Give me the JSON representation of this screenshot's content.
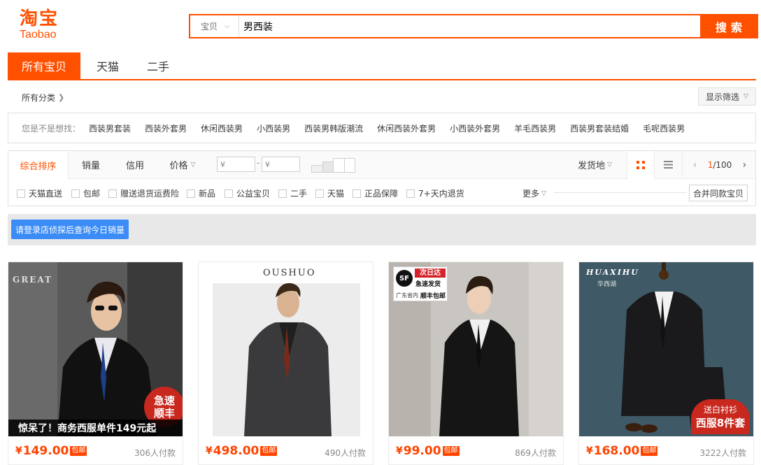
{
  "logo": {
    "cn": "淘宝",
    "en": "Taobao"
  },
  "search": {
    "category": "宝贝",
    "query": "男西装",
    "button": "搜索"
  },
  "tabs": [
    {
      "label": "所有宝贝",
      "active": true
    },
    {
      "label": "天猫",
      "active": false
    },
    {
      "label": "二手",
      "active": false
    }
  ],
  "breadcrumb": "所有分类",
  "filter_toggle": "显示筛选",
  "suggest": {
    "label": "您是不是想找：",
    "keywords": [
      "西装男套装",
      "西装外套男",
      "休闲西装男",
      "小西装男",
      "西装男韩版潮流",
      "休闲西装外套男",
      "小西装外套男",
      "羊毛西装男",
      "西装男套装结婚",
      "毛呢西装男"
    ]
  },
  "sort": {
    "options": [
      "综合排序",
      "销量",
      "信用",
      "价格"
    ],
    "price_min_placeholder": "¥",
    "price_max_placeholder": "¥",
    "ship_from": "发货地",
    "page_current": "1",
    "page_total": "/100"
  },
  "checkboxes": [
    "天猫直送",
    "包邮",
    "赠送退货运费险",
    "新品",
    "公益宝贝",
    "二手",
    "天猫",
    "正品保障",
    "7+天内退货"
  ],
  "more": "更多",
  "merge": "合并同款宝贝",
  "notice_button": "请登录店侦探后查询今日销量",
  "products": [
    {
      "price": "149.00",
      "sold": "306人付款",
      "free_ship": "包邮",
      "banner": "惊呆了！商务西服单件149元起",
      "badge": [
        "急速",
        "顺丰"
      ],
      "brand": "GREAT"
    },
    {
      "price": "498.00",
      "sold": "490人付款",
      "free_ship": "包邮",
      "brand": "OUSHUO"
    },
    {
      "price": "99.00",
      "sold": "869人付款",
      "free_ship": "包邮",
      "stamp": [
        "次日达",
        "急速发货",
        "广东省内",
        "顺丰包邮"
      ],
      "stamp_logo": "SF"
    },
    {
      "price": "168.00",
      "sold": "3222人付款",
      "free_ship": "包邮",
      "brand": "HUAXIHU",
      "brand_cn": "华西湖",
      "badge": [
        "送白衬衫",
        "西服8件套"
      ]
    }
  ],
  "currency": "¥",
  "colors": {
    "accent": "#ff5000",
    "price": "#ff4400",
    "notice_btn": "#3b8cf7"
  }
}
